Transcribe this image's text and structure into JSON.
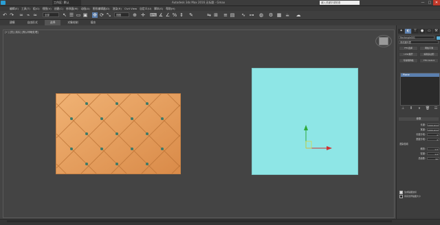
{
  "titlebar": {
    "doc_tab": "工作区: 默认",
    "app_title": "Autodesk 3ds Max 2016    无标题 - Gmax",
    "search_text": "键入关键字或短语",
    "min": "—",
    "max": "□",
    "close": "✕"
  },
  "menubar": {
    "items": [
      "编辑(E)",
      "工具(T)",
      "组(G)",
      "视图(V)",
      "创建(C)",
      "修改器(M)",
      "动画(A)",
      "图形编辑器(D)",
      "渲染(R)",
      "Civil View",
      "自定义(U)",
      "脚本(S)",
      "帮助(H)"
    ]
  },
  "toolbar": {
    "filter_select": "全部",
    "view_select": "视图"
  },
  "ribbon": {
    "tabs": [
      "建模",
      "自由形式",
      "选择",
      "对象绘制",
      "填充"
    ]
  },
  "viewport": {
    "label": "[+] [顶] [真实] [默认明暗处理]"
  },
  "command_panel": {
    "object_name": "Rectangle001",
    "modifier_list": "修改器列表",
    "buttons": [
      "FFD选择",
      "网格平滑",
      "UVW展开",
      "编辑多边形",
      "可编辑网格",
      "FFD 4x4x4"
    ],
    "stack_item": "Plane",
    "rollout_title": "参数",
    "params": [
      {
        "label": "长度:",
        "value": "1000.0mm"
      },
      {
        "label": "宽度:",
        "value": "1000.0mm"
      },
      {
        "label": "长度分段:",
        "value": "4"
      },
      {
        "label": "宽度分段:",
        "value": "4"
      }
    ],
    "render_section": "渲染倍增",
    "render_params": [
      {
        "label": "缩放:",
        "value": "1.0"
      },
      {
        "label": "密度:",
        "value": "1.0"
      },
      {
        "label": "总面数:",
        "value": "32"
      }
    ],
    "checks": [
      {
        "label": "生成贴图坐标",
        "on": true
      },
      {
        "label": "真实世界贴图大小",
        "on": false
      }
    ]
  },
  "colors": {
    "quilt": "#e6a061",
    "plain_panel": "#8ee6e6",
    "accent": "#5b7fae"
  }
}
